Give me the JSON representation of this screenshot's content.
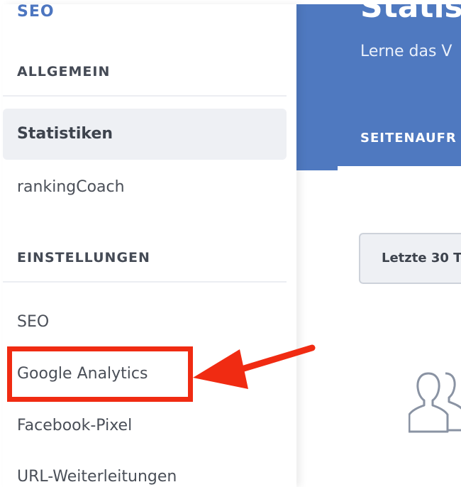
{
  "sidebar": {
    "title": "SEO",
    "sections": [
      {
        "header": "ALLGEMEIN",
        "items": [
          {
            "label": "Statistiken",
            "active": true
          },
          {
            "label": "rankingCoach",
            "active": false
          }
        ]
      },
      {
        "header": "EINSTELLUNGEN",
        "items": [
          {
            "label": "SEO",
            "active": false
          },
          {
            "label": "Google Analytics",
            "active": false,
            "highlighted": true
          },
          {
            "label": "Facebook-Pixel",
            "active": false
          },
          {
            "label": "URL-Weiterleitungen",
            "active": false
          }
        ]
      }
    ]
  },
  "main": {
    "title": "Statis",
    "subtitle": "Lerne das V",
    "tab_label": "SEITENAUFR",
    "date_button_label": "Letzte 30 T",
    "empty_state_icon": "users-icon"
  },
  "annotation": {
    "highlight_color": "#f02b12",
    "arrow_icon": "arrow-left-icon"
  },
  "colors": {
    "accent": "#4f79c0",
    "sidebar_title": "#4d76c0",
    "active_bg": "#eef0f4"
  }
}
